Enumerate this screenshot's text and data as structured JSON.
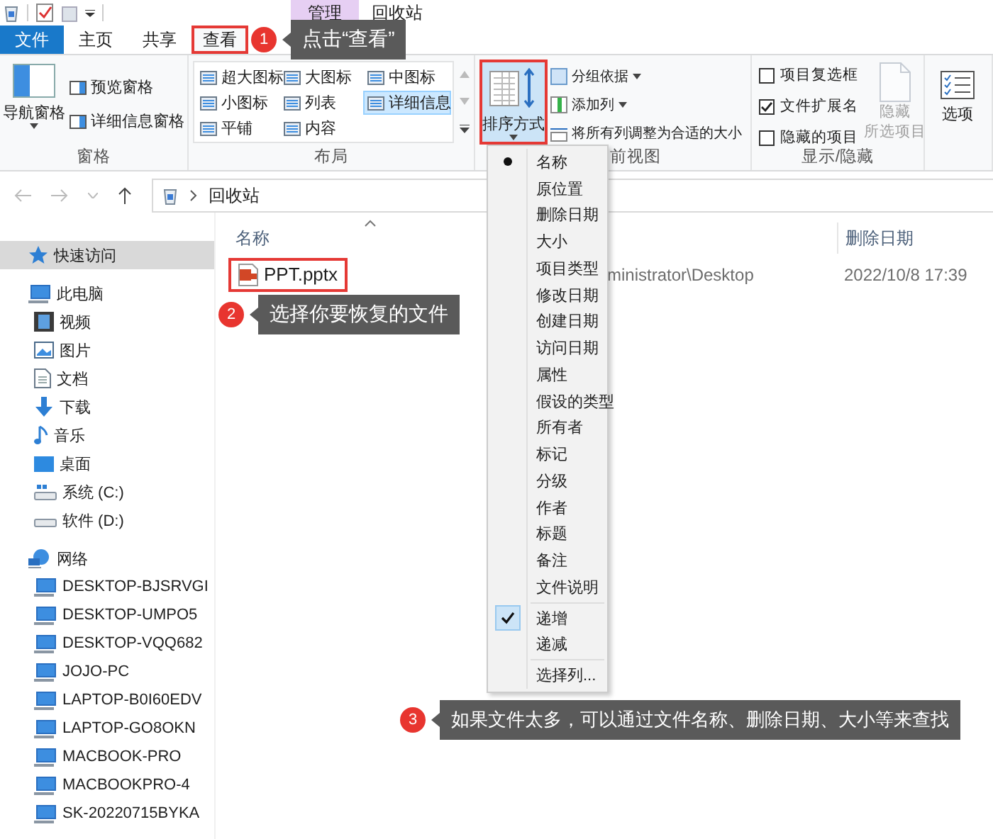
{
  "title_bar": {
    "context_tab": "管理",
    "title": "回收站"
  },
  "tabs": [
    {
      "label": "文件",
      "kind": "file",
      "selected": false,
      "highlighted": false
    },
    {
      "label": "主页",
      "kind": "tab",
      "selected": false,
      "highlighted": false
    },
    {
      "label": "共享",
      "kind": "tab",
      "selected": false,
      "highlighted": false
    },
    {
      "label": "查看",
      "kind": "tab",
      "selected": true,
      "highlighted": true
    }
  ],
  "ribbon": {
    "pane_group": {
      "label": "窗格",
      "navigation_pane": "导航窗格",
      "buttons": [
        "预览窗格",
        "详细信息窗格"
      ]
    },
    "layout_group": {
      "label": "布局",
      "options": [
        {
          "label": "超大图标",
          "selected": false
        },
        {
          "label": "大图标",
          "selected": false
        },
        {
          "label": "中图标",
          "selected": false
        },
        {
          "label": "小图标",
          "selected": false
        },
        {
          "label": "列表",
          "selected": false
        },
        {
          "label": "详细信息",
          "selected": true
        },
        {
          "label": "平铺",
          "selected": false
        },
        {
          "label": "内容",
          "selected": false
        }
      ]
    },
    "current_view_group": {
      "label": "前视图",
      "sort_button": {
        "label": "排序方式",
        "highlighted": true
      },
      "commands": [
        {
          "label": "分组依据",
          "dropdown": true
        },
        {
          "label": "添加列",
          "dropdown": true
        },
        {
          "label": "将所有列调整为合适的大小",
          "dropdown": false
        }
      ]
    },
    "show_hide_group": {
      "label": "显示/隐藏",
      "checkboxes": [
        {
          "label": "项目复选框",
          "checked": false
        },
        {
          "label": "文件扩展名",
          "checked": true
        },
        {
          "label": "隐藏的项目",
          "checked": false
        }
      ],
      "hide_selected": {
        "lines": [
          "隐藏",
          "所选项目"
        ],
        "disabled": true
      }
    },
    "options_button": "选项"
  },
  "address_bar": {
    "path": "回收站"
  },
  "navigation": [
    {
      "label": "快速访问",
      "kind": "star",
      "selected": true
    },
    {
      "label": "此电脑",
      "kind": "computer",
      "selected": false,
      "children": [
        {
          "label": "视频",
          "kind": "video",
          "selected": false
        },
        {
          "label": "图片",
          "kind": "pictures",
          "selected": false
        },
        {
          "label": "文档",
          "kind": "documents",
          "selected": false
        },
        {
          "label": "下载",
          "kind": "downloads",
          "selected": false
        },
        {
          "label": "音乐",
          "kind": "music",
          "selected": false
        },
        {
          "label": "桌面",
          "kind": "desktop",
          "selected": false
        },
        {
          "label": "系统 (C:)",
          "kind": "system_drive",
          "selected": false
        },
        {
          "label": "软件 (D:)",
          "kind": "drive",
          "selected": false
        }
      ]
    },
    {
      "label": "网络",
      "kind": "network",
      "selected": false,
      "children": [
        {
          "label": "DESKTOP-BJSRVGI",
          "kind": "pc",
          "selected": false
        },
        {
          "label": "DESKTOP-UMPO5",
          "kind": "pc",
          "selected": false
        },
        {
          "label": "DESKTOP-VQQ682",
          "kind": "pc",
          "selected": false
        },
        {
          "label": "JOJO-PC",
          "kind": "pc",
          "selected": false
        },
        {
          "label": "LAPTOP-B0I60EDV",
          "kind": "pc",
          "selected": false
        },
        {
          "label": "LAPTOP-GO8OKN",
          "kind": "pc",
          "selected": false
        },
        {
          "label": "MACBOOK-PRO",
          "kind": "pc",
          "selected": false
        },
        {
          "label": "MACBOOKPRO-4",
          "kind": "pc",
          "selected": false
        },
        {
          "label": "SK-20220715BYKA",
          "kind": "pc",
          "selected": false
        }
      ]
    }
  ],
  "file_list": {
    "columns": [
      {
        "label": "名称",
        "sorted": true
      },
      {
        "label": "删除日期",
        "sorted": false
      }
    ],
    "rows": [
      {
        "name": "PPT.pptx",
        "original_location": "ministrator\\Desktop",
        "deleted_date": "2022/10/8 17:39",
        "highlighted": true
      }
    ]
  },
  "sort_menu": [
    {
      "label": "名称",
      "kind": "field",
      "selected": true
    },
    {
      "label": "原位置",
      "kind": "field",
      "selected": false
    },
    {
      "label": "删除日期",
      "kind": "field",
      "selected": false
    },
    {
      "label": "大小",
      "kind": "field",
      "selected": false
    },
    {
      "label": "项目类型",
      "kind": "field",
      "selected": false
    },
    {
      "label": "修改日期",
      "kind": "field",
      "selected": false
    },
    {
      "label": "创建日期",
      "kind": "field",
      "selected": false
    },
    {
      "label": "访问日期",
      "kind": "field",
      "selected": false
    },
    {
      "label": "属性",
      "kind": "field",
      "selected": false
    },
    {
      "label": "假设的类型",
      "kind": "field",
      "selected": false
    },
    {
      "label": "所有者",
      "kind": "field",
      "selected": false
    },
    {
      "label": "标记",
      "kind": "field",
      "selected": false
    },
    {
      "label": "分级",
      "kind": "field",
      "selected": false
    },
    {
      "label": "作者",
      "kind": "field",
      "selected": false
    },
    {
      "label": "标题",
      "kind": "field",
      "selected": false
    },
    {
      "label": "备注",
      "kind": "field",
      "selected": false
    },
    {
      "label": "文件说明",
      "kind": "field",
      "selected": false
    },
    {
      "label": "递增",
      "kind": "order",
      "selected": true
    },
    {
      "label": "递减",
      "kind": "order",
      "selected": false
    },
    {
      "label": "选择列...",
      "kind": "action"
    }
  ],
  "callouts": [
    {
      "number": "1",
      "text": "点击“查看”"
    },
    {
      "number": "2",
      "text": "选择你要恢复的文件"
    },
    {
      "number": "3",
      "text": "如果文件太多，可以通过文件名称、删除日期、大小等来查找"
    }
  ]
}
